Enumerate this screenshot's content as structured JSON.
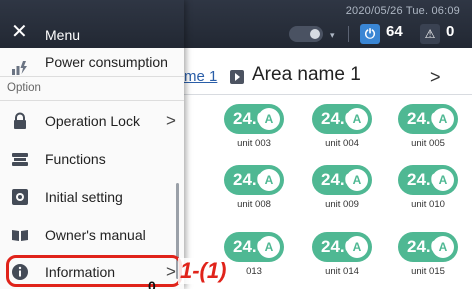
{
  "header": {
    "datetime": "2020/05/26 Tue. 06:09",
    "power_count": "64",
    "alert_count": "0"
  },
  "area": {
    "prev_label": "me 1",
    "title": "Area name 1",
    "next_glyph": ">"
  },
  "units": [
    {
      "temp": "24.0",
      "mode": "A",
      "name": "unit 003"
    },
    {
      "temp": "24.0",
      "mode": "A",
      "name": "unit 004"
    },
    {
      "temp": "24.0",
      "mode": "A",
      "name": "unit 005"
    },
    {
      "temp": "24.0",
      "mode": "A",
      "name": "unit 008"
    },
    {
      "temp": "24.0",
      "mode": "A",
      "name": "unit 009"
    },
    {
      "temp": "24.0",
      "mode": "A",
      "name": "unit 010"
    },
    {
      "temp": "24.0",
      "mode": "A",
      "name": "013"
    },
    {
      "temp": "24.0",
      "mode": "A",
      "name": "unit 014"
    },
    {
      "temp": "24.0",
      "mode": "A",
      "name": "unit 015"
    }
  ],
  "menu": {
    "close_glyph": "✕",
    "title": "Menu",
    "section_option": "Option",
    "items": [
      {
        "label": "Power consumption",
        "icon": "power-consumption-icon"
      },
      {
        "label": "Operation Lock",
        "icon": "lock-icon",
        "chevron": ">"
      },
      {
        "label": "Functions",
        "icon": "functions-icon"
      },
      {
        "label": "Initial setting",
        "icon": "settings-icon"
      },
      {
        "label": "Owner's manual",
        "icon": "book-icon"
      },
      {
        "label": "Information",
        "icon": "info-icon",
        "chevron": ">"
      }
    ]
  },
  "annotation": {
    "callout": "1-(1)",
    "cursor": "0"
  },
  "colors": {
    "header_bg": "#2a303c",
    "unit_green": "#4fb893",
    "highlight_red": "#e0231a",
    "power_blue": "#3a86d4"
  }
}
